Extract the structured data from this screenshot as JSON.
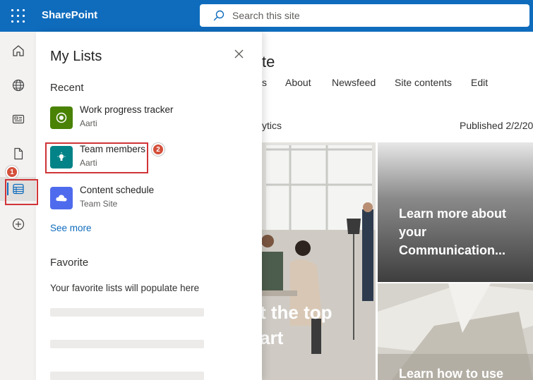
{
  "app": {
    "brand": "SharePoint",
    "search_placeholder": "Search this site"
  },
  "rail": {
    "items": [
      "home-icon",
      "globe-icon",
      "news-icon",
      "document-icon",
      "my-lists-icon",
      "create-icon"
    ]
  },
  "panel": {
    "title": "My Lists",
    "recent_heading": "Recent",
    "recent": [
      {
        "name": "Work progress tracker",
        "sub": "Aarti",
        "color": "#498205"
      },
      {
        "name": "Team members",
        "sub": "Aarti",
        "color": "#038387"
      },
      {
        "name": "Content schedule",
        "sub": "Team Site",
        "color": "#4f6bed"
      }
    ],
    "see_more": "See more",
    "favorite_heading": "Favorite",
    "favorite_empty": "Your favorite lists will populate here"
  },
  "callouts": {
    "one": "1",
    "two": "2"
  },
  "page": {
    "title_fragment": "te",
    "nav": [
      "s",
      "About",
      "Newsfeed",
      "Site contents",
      "Edit"
    ],
    "analytics_fragment": "ytics",
    "published": "Published 2/2/20",
    "hero_main_line1": "t the top",
    "hero_main_line2": "art",
    "hero_tr": "Learn more about your Communication...",
    "hero_br": "Learn how to use"
  },
  "colors": {
    "suite_bar": "#0f6cbd",
    "callout_red": "#d13438"
  }
}
